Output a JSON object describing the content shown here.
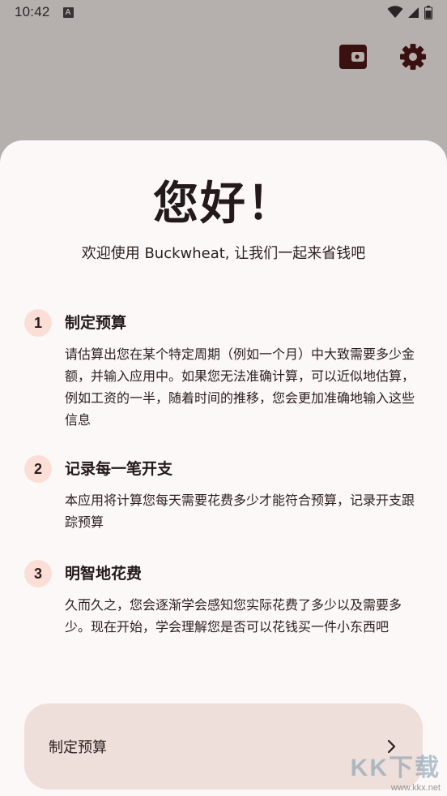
{
  "status_bar": {
    "time": "10:42",
    "notification_icon": "a-badge-icon",
    "icons": [
      "wifi-icon",
      "signal-icon",
      "battery-icon"
    ]
  },
  "top_actions": {
    "wallet_icon": "wallet-icon",
    "settings_icon": "gear-icon"
  },
  "sheet": {
    "title": "您好！",
    "subtitle": "欢迎使用 Buckwheat, 让我们一起来省钱吧",
    "steps": [
      {
        "number": "1",
        "title": "制定预算",
        "body": "请估算出您在某个特定周期（例如一个月）中大致需要多少金额，并输入应用中。如果您无法准确计算，可以近似地估算，例如工资的一半，随着时间的推移，您会更加准确地输入这些信息"
      },
      {
        "number": "2",
        "title": "记录每一笔开支",
        "body": "本应用将计算您每天需要花费多少才能符合预算，记录开支跟踪预算"
      },
      {
        "number": "3",
        "title": "明智地花费",
        "body": "久而久之，您会逐渐学会感知您实际花费了多少以及需要多少。现在开始，学会理解您是否可以花钱买一件小东西吧"
      }
    ],
    "cta_label": "制定预算",
    "cta_icon": "chevron-right-icon"
  },
  "watermark": {
    "main": "KK下载",
    "url": "www.kkx.net"
  },
  "colors": {
    "scrim": "#b5afad",
    "sheet": "#fdf8f8",
    "step_badge": "#fbdfd6",
    "cta_bg": "#efdfdb",
    "icon_dark": "#3a1111"
  }
}
